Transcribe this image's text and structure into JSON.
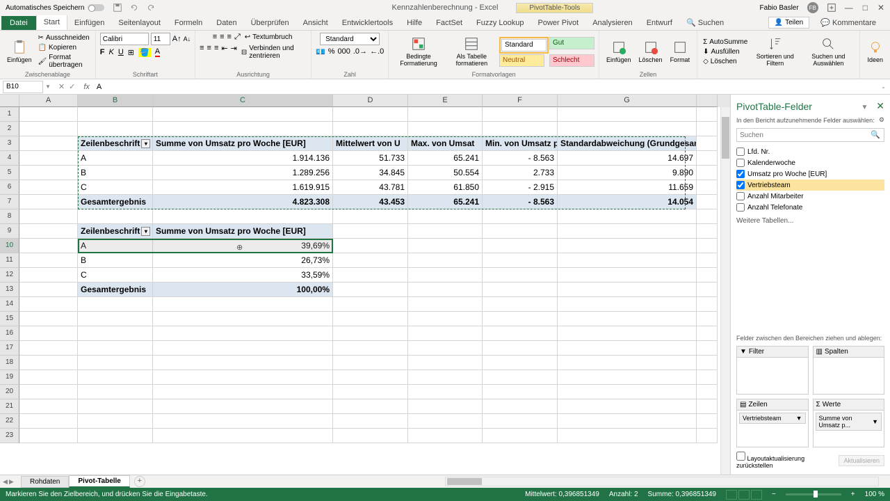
{
  "title_bar": {
    "autosave": "Automatisches Speichern",
    "doc_title": "Kennzahlenberechnung - Excel",
    "pivot_tools": "PivotTable-Tools",
    "user_name": "Fabio Basler",
    "user_initials": "FB"
  },
  "ribbon": {
    "file": "Datei",
    "tabs": [
      "Start",
      "Einfügen",
      "Seitenlayout",
      "Formeln",
      "Daten",
      "Überprüfen",
      "Ansicht",
      "Entwicklertools",
      "Hilfe",
      "FactSet",
      "Fuzzy Lookup",
      "Power Pivot",
      "Analysieren",
      "Entwurf"
    ],
    "search": "Suchen",
    "teilen": "Teilen",
    "kommentare": "Kommentare",
    "clipboard": {
      "paste": "Einfügen",
      "cut": "Ausschneiden",
      "copy": "Kopieren",
      "format_painter": "Format übertragen",
      "label": "Zwischenablage"
    },
    "font": {
      "name": "Calibri",
      "size": "11",
      "label": "Schriftart"
    },
    "alignment": {
      "wrap": "Textumbruch",
      "merge": "Verbinden und zentrieren",
      "label": "Ausrichtung"
    },
    "number": {
      "format": "Standard",
      "label": "Zahl"
    },
    "format": {
      "cond": "Bedingte Formatierung",
      "table": "Als Tabelle formatieren",
      "label": "Formatvorlagen"
    },
    "styles": {
      "standard": "Standard",
      "gut": "Gut",
      "neutral": "Neutral",
      "schlecht": "Schlecht"
    },
    "cells": {
      "insert": "Einfügen",
      "delete": "Löschen",
      "format": "Format",
      "label": "Zellen"
    },
    "editing": {
      "autosum": "AutoSumme",
      "fill": "Ausfüllen",
      "clear": "Löschen",
      "sort": "Sortieren und Filtern",
      "find": "Suchen und Auswählen"
    },
    "ideas": "Ideen"
  },
  "formula_bar": {
    "name_box": "B10",
    "formula": "A"
  },
  "columns": [
    "A",
    "B",
    "C",
    "D",
    "E",
    "F",
    "G"
  ],
  "pivot1": {
    "headers": [
      "Zeilenbeschrift",
      "Summe von Umsatz pro Woche [EUR]",
      "Mittelwert von U",
      "Max. von Umsat",
      "Min. von Umsatz p",
      "Standardabweichung (Grundgesam"
    ],
    "rows": [
      {
        "label": "A",
        "vals": [
          "1.914.136",
          "51.733",
          "65.241",
          "-",
          "8.563",
          "14.697"
        ]
      },
      {
        "label": "B",
        "vals": [
          "1.289.256",
          "34.845",
          "50.554",
          "2.733",
          "",
          "9.890"
        ]
      },
      {
        "label": "C",
        "vals": [
          "1.619.915",
          "43.781",
          "61.850",
          "-",
          "2.915",
          "11.659"
        ]
      }
    ],
    "total_label": "Gesamtergebnis",
    "total_vals": [
      "4.823.308",
      "43.453",
      "65.241",
      "-",
      "8.563",
      "14.054"
    ]
  },
  "pivot2": {
    "headers": [
      "Zeilenbeschrift",
      "Summe von Umsatz pro Woche [EUR]"
    ],
    "rows": [
      {
        "label": "A",
        "val": "39,69%"
      },
      {
        "label": "B",
        "val": "26,73%"
      },
      {
        "label": "C",
        "val": "33,59%"
      }
    ],
    "total_label": "Gesamtergebnis",
    "total_val": "100,00%"
  },
  "task_pane": {
    "title": "PivotTable-Felder",
    "subtitle": "In den Bericht aufzunehmende Felder auswählen:",
    "search": "Suchen",
    "fields": [
      {
        "label": "Lfd. Nr.",
        "checked": false
      },
      {
        "label": "Kalenderwoche",
        "checked": false
      },
      {
        "label": "Umsatz pro Woche [EUR]",
        "checked": true
      },
      {
        "label": "Vertriebsteam",
        "checked": true
      },
      {
        "label": "Anzahl Mitarbeiter",
        "checked": false
      },
      {
        "label": "Anzahl Telefonate",
        "checked": false
      }
    ],
    "more_tables": "Weitere Tabellen...",
    "areas_label": "Felder zwischen den Bereichen ziehen und ablegen:",
    "filter": "Filter",
    "spalten": "Spalten",
    "zeilen": "Zeilen",
    "werte": "Werte",
    "zeilen_item": "Vertriebsteam",
    "werte_item": "Summe von Umsatz p...",
    "defer": "Layoutaktualisierung zurückstellen",
    "update": "Aktualisieren"
  },
  "sheets": {
    "tabs": [
      "Rohdaten",
      "Pivot-Tabelle"
    ],
    "active": 1
  },
  "status": {
    "message": "Markieren Sie den Zielbereich, und drücken Sie die Eingabetaste.",
    "mittelwert": "Mittelwert: 0,396851349",
    "anzahl": "Anzahl: 2",
    "summe": "Summe: 0,396851349",
    "zoom": "100 %"
  }
}
